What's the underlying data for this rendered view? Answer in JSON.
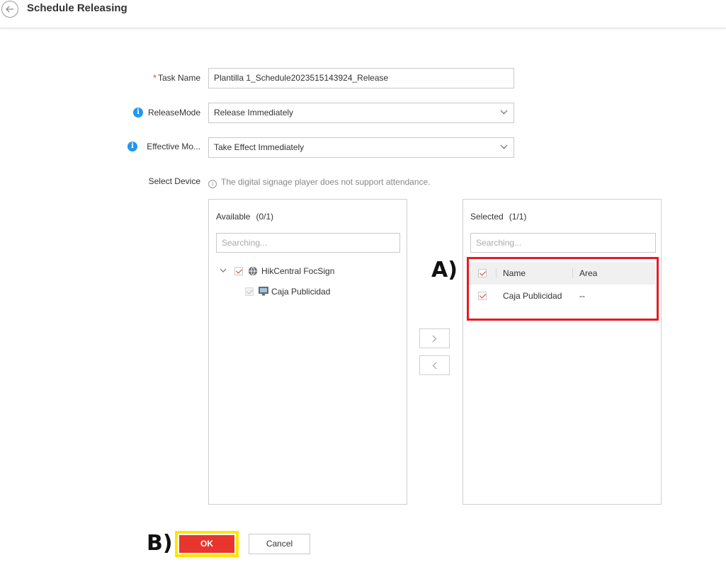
{
  "header": {
    "title": "Schedule Releasing",
    "back_icon": "back-arrow-icon"
  },
  "form": {
    "task_name": {
      "required_mark": "*",
      "label": "Task Name",
      "value": "Plantilla 1_Schedule2023515143924_Release"
    },
    "release_mode": {
      "label": "ReleaseMode",
      "value": "Release Immediately",
      "info_glyph": "i"
    },
    "effective_mode": {
      "label": "Effective Mo...",
      "value": "Take Effect Immediately",
      "info_glyph": "i"
    },
    "select_device": {
      "label": "Select Device",
      "hint": "The digital signage player does not support attendance.",
      "hint_glyph": "i"
    }
  },
  "available": {
    "title": "Available",
    "count": "(0/1)",
    "search_placeholder": "Searching...",
    "tree": {
      "root_label": "HikCentral FocSign",
      "root_icon": "globe-icon",
      "child_label": "Caja Publicidad",
      "child_icon": "monitor-icon"
    }
  },
  "transfer": {
    "add_icon": "chevron-right-icon",
    "remove_icon": "chevron-left-icon"
  },
  "selected": {
    "title": "Selected",
    "count": "(1/1)",
    "search_placeholder": "Searching...",
    "columns": [
      "Name",
      "Area"
    ],
    "rows": [
      {
        "name": "Caja Publicidad",
        "area": "--"
      }
    ]
  },
  "annotations": {
    "a_label": "A)",
    "b_label": "B)"
  },
  "footer": {
    "ok_label": "OK",
    "cancel_label": "Cancel"
  },
  "colors": {
    "accent_red": "#e8352e",
    "info_blue": "#2196f3",
    "annotation_red": "#e51a23",
    "annotation_yellow": "#ffe600"
  }
}
